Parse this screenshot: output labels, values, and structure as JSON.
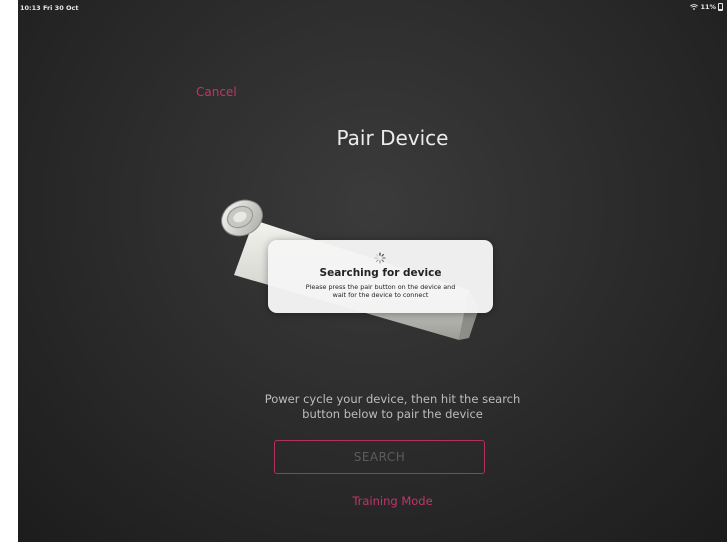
{
  "status_bar": {
    "time": "10:13  Fri 30 Oct",
    "battery": "11%"
  },
  "nav": {
    "cancel_label": "Cancel"
  },
  "page": {
    "title": "Pair Device",
    "instructions_line1": "Power cycle your device, then hit the search",
    "instructions_line2": "button below to pair the device"
  },
  "modal": {
    "title": "Searching for device",
    "message_line1": "Please press the pair button on the device and",
    "message_line2": "wait for the device to connect"
  },
  "actions": {
    "search_label": "SEARCH",
    "training_label": "Training Mode"
  },
  "colors": {
    "accent": "#c2356a",
    "background": "#2d2d2d",
    "modal_background": "#f5f5f5",
    "search_border": "#b0305f"
  },
  "icons": {
    "wifi": "wifi-icon",
    "battery": "battery-icon",
    "spinner": "loading-spinner-icon",
    "device": "device-illustration"
  }
}
